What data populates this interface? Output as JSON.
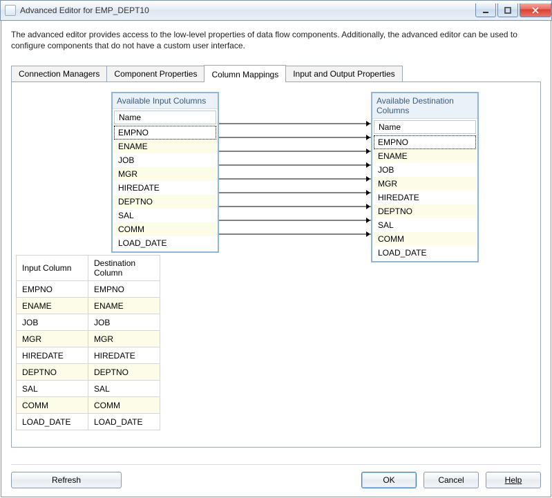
{
  "window": {
    "title": "Advanced Editor for EMP_DEPT10"
  },
  "description": "The advanced editor provides access to the low-level properties of data flow components. Additionally, the advanced editor can be used to configure components that do not have a custom user interface.",
  "tabs": [
    {
      "label": "Connection Managers"
    },
    {
      "label": "Component Properties"
    },
    {
      "label": "Column Mappings"
    },
    {
      "label": "Input and Output Properties"
    }
  ],
  "active_tab_index": 2,
  "input_box": {
    "caption": "Available Input Columns",
    "header": "Name",
    "rows": [
      "EMPNO",
      "ENAME",
      "JOB",
      "MGR",
      "HIREDATE",
      "DEPTNO",
      "SAL",
      "COMM",
      "LOAD_DATE"
    ]
  },
  "dest_box": {
    "caption": "Available Destination Columns",
    "header": "Name",
    "rows": [
      "EMPNO",
      "ENAME",
      "JOB",
      "MGR",
      "HIREDATE",
      "DEPTNO",
      "SAL",
      "COMM",
      "LOAD_DATE"
    ]
  },
  "grid": {
    "headers": [
      "Input Column",
      "Destination Column"
    ],
    "rows": [
      [
        "EMPNO",
        "EMPNO"
      ],
      [
        "ENAME",
        "ENAME"
      ],
      [
        "JOB",
        "JOB"
      ],
      [
        "MGR",
        "MGR"
      ],
      [
        "HIREDATE",
        "HIREDATE"
      ],
      [
        "DEPTNO",
        "DEPTNO"
      ],
      [
        "SAL",
        "SAL"
      ],
      [
        "COMM",
        "COMM"
      ],
      [
        "LOAD_DATE",
        "LOAD_DATE"
      ]
    ]
  },
  "buttons": {
    "refresh": "Refresh",
    "ok": "OK",
    "cancel": "Cancel",
    "help": "Help"
  },
  "help_underline": true
}
